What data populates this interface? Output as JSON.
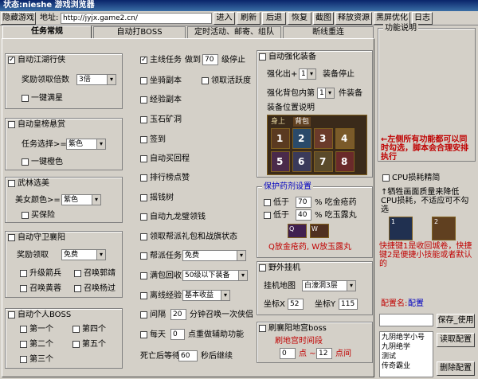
{
  "title": "状态:nieshe 游戏浏览器",
  "toolbar": {
    "hide_game": "隐藏游戏",
    "address_label": "地址:",
    "address_value": "http://jyjx.game2.cn/",
    "enter": "进入",
    "refresh": "刷新",
    "back": "后退",
    "restore": "恢复",
    "screenshot": "截图",
    "release": "释放资源",
    "blackscreen": "黑屏优化",
    "log": "日志"
  },
  "tabs": [
    "任务常规",
    "自动打BOSS",
    "定时活动、邮寄、组队",
    "断线重连"
  ],
  "col1": {
    "jianghu": {
      "label": "自动江湖行侠",
      "reward_label": "奖励领取倍数",
      "reward_value": "3倍",
      "oneclick": "一键满星"
    },
    "huangbang": {
      "label": "自动皇榜悬赏",
      "color_label": "任务选择>=",
      "color_value": "紫色",
      "oneclick": "一键橙色"
    },
    "wulin": {
      "label": "武林选美",
      "beauty_label": "美女颜色>=",
      "beauty_value": "紫色",
      "buy": "买保险"
    },
    "xiangyang": {
      "label": "自动守卫襄阳",
      "reward_label": "奖励领取",
      "reward_value": "免费",
      "opts": [
        "升级箭兵",
        "召唤郭靖",
        "召唤黄蓉",
        "召唤杨过"
      ]
    },
    "personal_boss": {
      "label": "自动个人BOSS",
      "opts": [
        "第一个",
        "第四个",
        "第二个",
        "第五个",
        "第三个"
      ]
    }
  },
  "col2": {
    "main_task": {
      "label": "主线任务",
      "stop_label1": "做到",
      "level": "70",
      "stop_label2": "级停止"
    },
    "items": [
      "坐骑副本",
      "领取活跃度",
      "经验副本",
      "玉石矿洞",
      "签到",
      "自动买回程",
      "排行榜点赞",
      "摇钱树",
      "自动九龙璧领钱",
      "领取帮派礼包和战旗状态"
    ],
    "guild": {
      "label": "帮派任务",
      "value": "免费"
    },
    "recycle": {
      "label": "满包回收",
      "value": "50级以下装备"
    },
    "offline": {
      "label": "离线经验",
      "value": "基本收益"
    },
    "interval": {
      "label": "间隔",
      "value": "20",
      "suffix": "分钟召唤一次侠侣"
    },
    "daily": {
      "label": "每天",
      "value": "0",
      "suffix": "点重做辅助功能"
    },
    "death": {
      "label": "死亡后等待",
      "value": "60",
      "suffix": "秒后继续"
    }
  },
  "col3": {
    "strengthen": {
      "label": "自动强化装备",
      "to_label": "强化出+",
      "to_value": "1",
      "to_suffix": "装备停止",
      "bag_label": "强化背包内第",
      "bag_value": "1",
      "bag_suffix": "件装备",
      "pos_label": "装备位置说明",
      "tab_body": "身上",
      "tab_bag": "背包",
      "slots": [
        "1",
        "2",
        "3",
        "4",
        "5",
        "6",
        "7",
        "8"
      ]
    },
    "potion": {
      "title": "保护药剂设置",
      "low1": "低于",
      "v1": "70",
      "s1": "% 吃金疮药",
      "low2": "低于",
      "v2": "40",
      "s2": "% 吃玉露丸",
      "note": "Q放金疮药, W放玉露丸",
      "keys": [
        "Q",
        "W"
      ]
    },
    "hangup": {
      "label": "野外挂机",
      "map_label": "挂机地图",
      "map_value": "白濠洞3层",
      "x_label": "坐标X",
      "x_value": "52",
      "y_label": "坐标Y",
      "y_value": "115"
    },
    "refresh_boss": {
      "label": "刷襄阳地宫boss",
      "time_label": "刷地宫时间段",
      "from": "0",
      "to_label": "点 ~",
      "to": "12",
      "unit": "点间"
    }
  },
  "right": {
    "title": "功能说明",
    "note1": "←左侧所有功能都可以同时勾选，脚本会合理安排执行",
    "cpu": "CPU损耗精简",
    "note2": "↑牺牲画面质量来降低CPU损耗，不适应可不勾选",
    "note3": "快捷键1是收回城卷，快捷键2是便捷小技能或者默认的",
    "config_label": "配置名:",
    "config_value": "配置",
    "save": "保存_使用",
    "read": "读取配置",
    "delete": "删除配置",
    "list": [
      "九阴绝学小号",
      "九阴绝学",
      "测试",
      "传奇霸业"
    ],
    "keys": [
      "1",
      "2"
    ]
  }
}
